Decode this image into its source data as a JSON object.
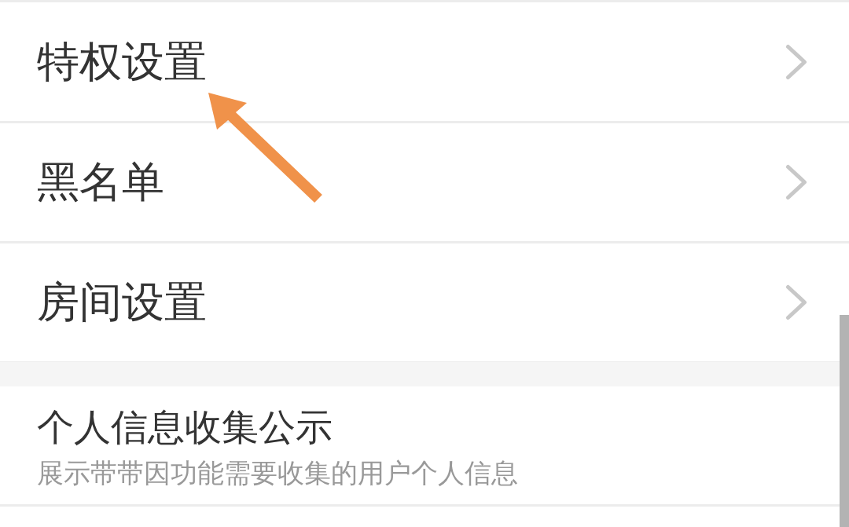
{
  "sections": [
    {
      "items": [
        {
          "kind": "nav",
          "title": "特权设置"
        },
        {
          "kind": "nav",
          "title": "黑名单"
        },
        {
          "kind": "nav",
          "title": "房间设置"
        }
      ]
    },
    {
      "items": [
        {
          "kind": "info",
          "title": "个人信息收集公示",
          "subtitle": "展示带带因功能需要收集的用户个人信息"
        }
      ]
    }
  ]
}
